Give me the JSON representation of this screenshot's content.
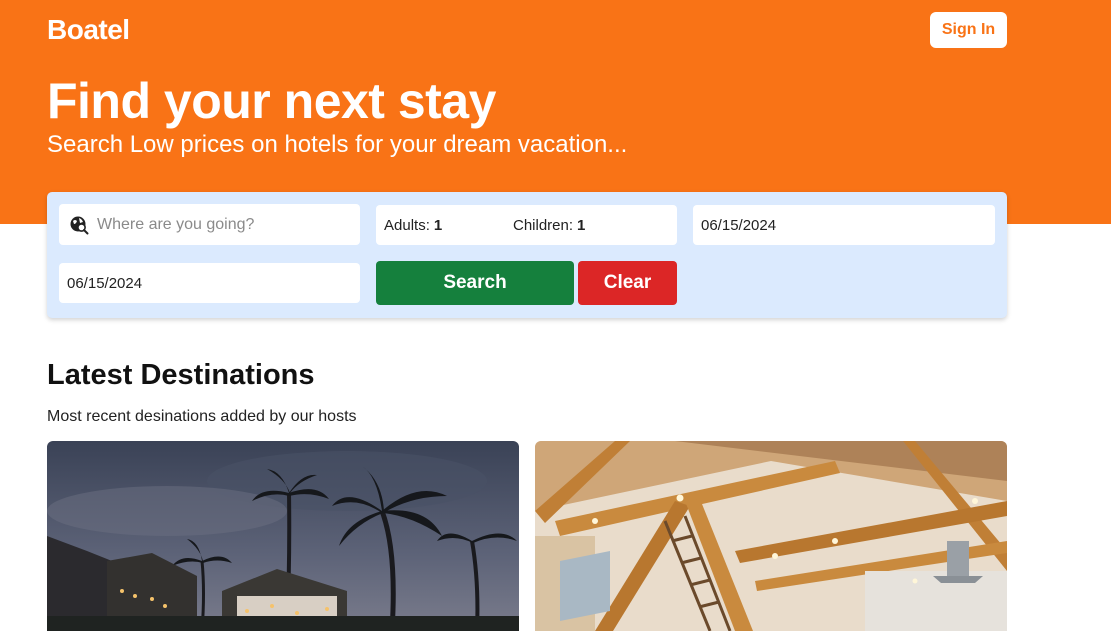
{
  "header": {
    "logo": "Boatel",
    "sign_in_label": "Sign In",
    "title": "Find your next stay",
    "subtitle": "Search Low prices on hotels for your dream vacation..."
  },
  "search": {
    "destination_placeholder": "Where are you going?",
    "destination_icon": "globe-search-icon",
    "adults_label": "Adults:",
    "adults_value": "1",
    "children_label": "Children:",
    "children_value": "1",
    "check_in": "06/15/2024",
    "check_out": "06/15/2024",
    "search_label": "Search",
    "clear_label": "Clear"
  },
  "destinations": {
    "title": "Latest Destinations",
    "subtitle": "Most recent desinations added by our hosts",
    "cards": [
      {
        "image": "tropical-resort-photo"
      },
      {
        "image": "wooden-cabin-interior-photo"
      }
    ]
  },
  "colors": {
    "brand": "#f97316",
    "search_panel": "#dbeafe",
    "search_button": "#15803d",
    "clear_button": "#dc2626"
  }
}
